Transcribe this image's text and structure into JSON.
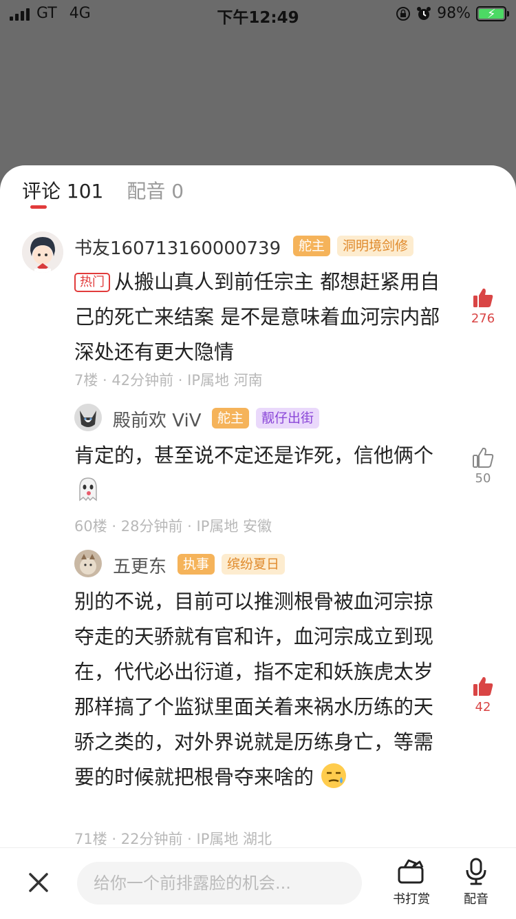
{
  "status_bar": {
    "carrier": "GT",
    "network": "4G",
    "time": "下午12:49",
    "battery": "98%"
  },
  "tabs": [
    {
      "label": "评论 101",
      "active": true
    },
    {
      "label": "配音 0",
      "active": false
    }
  ],
  "comments": [
    {
      "username": "书友160713160000739",
      "badges": [
        "舵主",
        "洞明境剑修"
      ],
      "hot_tag": "热门",
      "text": "从搬山真人到前任宗主 都想赶紧用自己的死亡来结案 是不是意味着血河宗内部深处还有更大隐情",
      "meta": "7楼 · 42分钟前 · IP属地 河南",
      "likes": "276",
      "liked": true
    },
    {
      "username": "殿前欢 ViV",
      "badges": [
        "舵主",
        "靓仔出街"
      ],
      "text": "肯定的，甚至说不定还是诈死，信他俩个",
      "meta": "60楼 · 28分钟前 · IP属地 安徽",
      "likes": "50",
      "liked": false
    },
    {
      "username": "五更东",
      "badges": [
        "执事",
        "缤纷夏日"
      ],
      "text": "别的不说，目前可以推测根骨被血河宗掠夺走的天骄就有官和许，血河宗成立到现在，代代必出衍道，指不定和妖族虎太岁那样搞了个监狱里面关着来祸水历练的天骄之类的，对外界说就是历练身亡，等需要的时候就把根骨夺来啥的",
      "meta": "71楼 · 22分钟前 · IP属地 湖北",
      "likes": "42",
      "liked": true
    }
  ],
  "bottom_bar": {
    "input_placeholder": "给你一个前排露脸的机会...",
    "tip_label": "书打赏",
    "dub_label": "配音"
  },
  "colors": {
    "accent_red": "#e13b3b",
    "badge_orange": "#f5b35a",
    "badge_purple": "#8a46d8"
  }
}
